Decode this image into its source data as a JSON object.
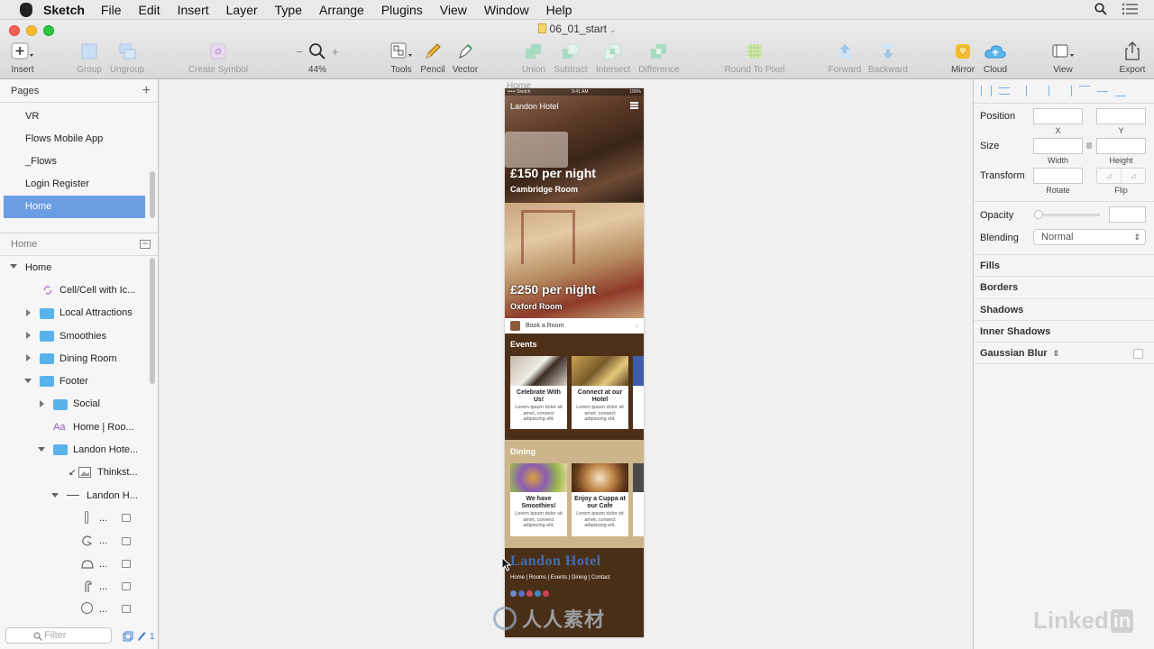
{
  "menubar": {
    "app": "Sketch",
    "items": [
      "File",
      "Edit",
      "Insert",
      "Layer",
      "Type",
      "Arrange",
      "Plugins",
      "View",
      "Window",
      "Help"
    ]
  },
  "window": {
    "document_title": "06_01_start"
  },
  "toolbar": {
    "insert": "Insert",
    "group": "Group",
    "ungroup": "Ungroup",
    "create_symbol": "Create Symbol",
    "zoom_minus": "−",
    "zoom_plus": "+",
    "zoom": "44%",
    "tools": "Tools",
    "pencil": "Pencil",
    "vector": "Vector",
    "union": "Union",
    "subtract": "Subtract",
    "intersect": "Intersect",
    "difference": "Difference",
    "round_to_pixel": "Round To Pixel",
    "forward": "Forward",
    "backward": "Backward",
    "mirror": "Mirror",
    "cloud": "Cloud",
    "view": "View",
    "export": "Export"
  },
  "sidebar": {
    "pages_header": "Pages",
    "pages": [
      "VR",
      "Flows Mobile App",
      "_Flows",
      "Login Register",
      "Home"
    ],
    "active_page": "Home",
    "layers_header": "Home",
    "layers": [
      {
        "label": "Home",
        "kind": "page"
      },
      {
        "label": "Cell/Cell with Ic...",
        "kind": "symbol"
      },
      {
        "label": "Local Attractions",
        "kind": "folder"
      },
      {
        "label": "Smoothies",
        "kind": "folder"
      },
      {
        "label": "Dining Room",
        "kind": "folder"
      },
      {
        "label": "Footer",
        "kind": "folder-open"
      },
      {
        "label": "Social",
        "kind": "folder"
      },
      {
        "label": "Home | Roo...",
        "kind": "text"
      },
      {
        "label": "Landon Hote...",
        "kind": "folder-open"
      },
      {
        "label": "Thinkst...",
        "kind": "image"
      },
      {
        "label": "Landon H...",
        "kind": "line"
      },
      {
        "label": "...",
        "kind": "shape"
      },
      {
        "label": "...",
        "kind": "shape"
      },
      {
        "label": "...",
        "kind": "shape"
      },
      {
        "label": "...",
        "kind": "shape"
      },
      {
        "label": "...",
        "kind": "shape"
      }
    ],
    "filter_placeholder": "Filter",
    "filter_count": "1"
  },
  "canvas": {
    "artboard_name": "Home",
    "status_left": "••••• Sketch",
    "status_time": "9:41 AM",
    "status_right": "100%",
    "hotel_name": "Landon Hotel",
    "rooms": [
      {
        "price": "£150 per night",
        "name": "Cambridge Room"
      },
      {
        "price": "£250 per night",
        "name": "Oxford Room"
      }
    ],
    "book_label": "Book a Room",
    "events_title": "Events",
    "events_cards": [
      {
        "title": "Celebrate With Us!",
        "body": "Lorem ipsum dolor sit amet, consect adipiscing elit."
      },
      {
        "title": "Connect at our Hotel",
        "body": "Lorem ipsum dolor sit amet, consect adipiscing elit."
      }
    ],
    "dining_title": "Dining",
    "dining_cards": [
      {
        "title": "We have Smoothies!",
        "body": "Lorem ipsum dolor sit amet, consect adipiscing elit."
      },
      {
        "title": "Enjoy a Cuppa at our Cafe",
        "body": "Lorem ipsum dolor sit amet, consect adipiscing elit."
      }
    ],
    "footer_logo": "Landon Hotel",
    "footer_nav": "Home | Rooms | Events | Dining | Contact"
  },
  "inspector": {
    "position": "Position",
    "x": "X",
    "y": "Y",
    "size": "Size",
    "width": "Width",
    "height": "Height",
    "transform": "Transform",
    "rotate": "Rotate",
    "flip": "Flip",
    "opacity": "Opacity",
    "blending": "Blending",
    "blending_value": "Normal",
    "sections": [
      "Fills",
      "Borders",
      "Shadows",
      "Inner Shadows",
      "Gaussian Blur"
    ]
  },
  "watermarks": {
    "linkedin": "Linked",
    "linkedin_in": "in",
    "renren": "人人素材"
  },
  "colors": {
    "accent": "#6b9de3",
    "folder": "#5ab2ea",
    "artboard_brown": "#5a3a1f",
    "dining_tan": "#cdb58b"
  }
}
